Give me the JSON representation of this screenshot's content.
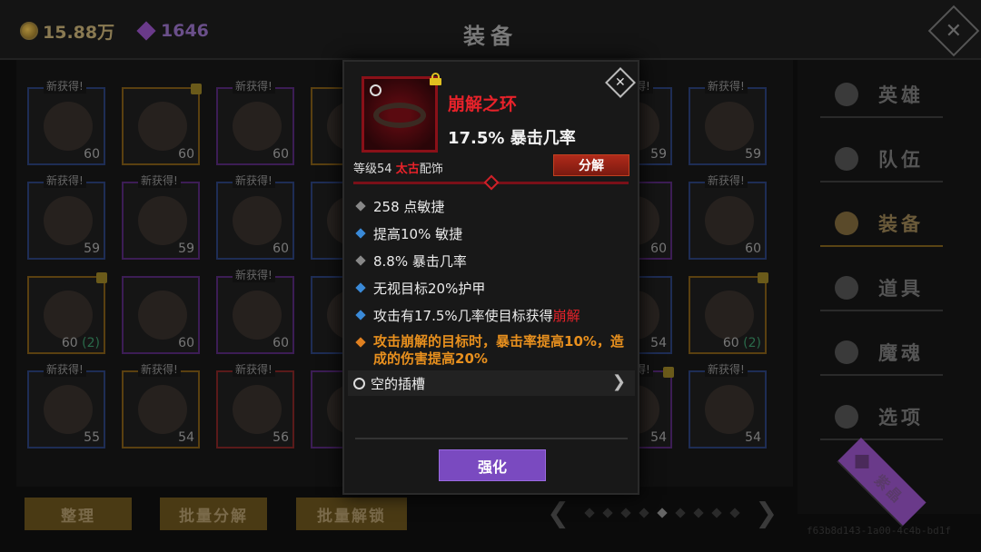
{
  "header": {
    "gold": "15.88万",
    "gems": "1646",
    "title": "装备",
    "close_icon": "close-icon"
  },
  "grid": {
    "new_label": "新获得!",
    "rows": [
      [
        {
          "level": "60",
          "new": true,
          "color": "blue",
          "art": "shield"
        },
        {
          "level": "60",
          "new": false,
          "color": "gold",
          "lock": true,
          "art": "book"
        },
        {
          "level": "60",
          "new": true,
          "color": "purple",
          "art": "cloak"
        },
        {
          "level": "",
          "new": false,
          "color": "gold",
          "art": "bow"
        }
      ],
      [
        {
          "level": "59",
          "new": true,
          "color": "blue",
          "art": "robe"
        },
        {
          "level": "59",
          "new": true,
          "color": "purple",
          "art": "armor"
        },
        {
          "level": "60",
          "new": true,
          "color": "blue",
          "art": "blade"
        },
        {
          "level": "",
          "new": false,
          "color": "blue",
          "art": "misc"
        }
      ],
      [
        {
          "level": "60",
          "extra": "(2)",
          "new": false,
          "color": "gold",
          "lock": true,
          "art": "boots"
        },
        {
          "level": "60",
          "new": false,
          "color": "purple",
          "art": "helm"
        },
        {
          "level": "60",
          "new": true,
          "color": "purple",
          "art": "shield"
        },
        {
          "level": "",
          "new": false,
          "color": "blue",
          "art": "misc"
        }
      ],
      [
        {
          "level": "55",
          "new": true,
          "color": "blue",
          "art": "dagger"
        },
        {
          "level": "54",
          "new": true,
          "color": "gold",
          "art": "helm"
        },
        {
          "level": "56",
          "new": true,
          "color": "red",
          "art": "boots"
        },
        {
          "level": "",
          "new": false,
          "color": "purple",
          "art": "misc"
        }
      ]
    ],
    "right_columns": [
      [
        {
          "level": "59",
          "new": true,
          "color": "blue",
          "art": "robe"
        },
        {
          "level": "59",
          "new": true,
          "color": "blue",
          "art": "robe"
        }
      ],
      [
        {
          "level": "60",
          "new": false,
          "color": "purple",
          "art": "armor"
        },
        {
          "level": "60",
          "new": true,
          "color": "blue",
          "art": "robe"
        }
      ],
      [
        {
          "level": "54",
          "new": false,
          "color": "blue",
          "art": "helm"
        },
        {
          "level": "60",
          "extra": "(2)",
          "new": false,
          "color": "gold",
          "lock": true,
          "art": "armor"
        }
      ],
      [
        {
          "level": "54",
          "new": true,
          "color": "purple",
          "lock": true,
          "art": "blade"
        },
        {
          "level": "54",
          "new": true,
          "color": "blue",
          "art": "shield"
        }
      ]
    ]
  },
  "sidebar": {
    "items": [
      {
        "label": "英雄",
        "icon": "heroes-icon"
      },
      {
        "label": "队伍",
        "icon": "flag-icon"
      },
      {
        "label": "装备",
        "icon": "helmet-icon",
        "active": true
      },
      {
        "label": "道具",
        "icon": "bag-icon"
      },
      {
        "label": "魔魂",
        "icon": "flame-icon"
      },
      {
        "label": "选项",
        "icon": "gear-icon"
      },
      {
        "label": "紫晶",
        "icon": "crystal-icon"
      }
    ]
  },
  "bottom": {
    "sort_label": "整理",
    "bulk_dismantle_label": "批量分解",
    "bulk_unlock_label": "批量解锁",
    "page_count": 9,
    "current_page": 5
  },
  "modal": {
    "item_name": "崩解之环",
    "main_stat": "17.5% 暴击几率",
    "level_prefix": "等级54 ",
    "quality": "太古",
    "slot_type": "配饰",
    "dismantle_label": "分解",
    "stats": [
      {
        "marker": "gray",
        "text": "258 点敏捷"
      },
      {
        "marker": "blue",
        "text": "提高10% 敏捷"
      },
      {
        "marker": "gray",
        "text": "8.8% 暴击几率"
      },
      {
        "marker": "blue",
        "text": "无视目标20%护甲"
      },
      {
        "marker": "blue",
        "text": "攻击有17.5%几率使目标获得",
        "highlight": "崩解"
      },
      {
        "marker": "orange",
        "text": "攻击崩解的目标时，暴击率提高10%，造成的伤害提高20%"
      }
    ],
    "socket_label": "空的插槽",
    "enhance_label": "强化",
    "colors": {
      "name": "#e8222a",
      "orange": "#e8901e",
      "enhance": "#7a4ac0"
    }
  },
  "footer_hash": "f63b8d143-1a00-4c4b-bd1f"
}
